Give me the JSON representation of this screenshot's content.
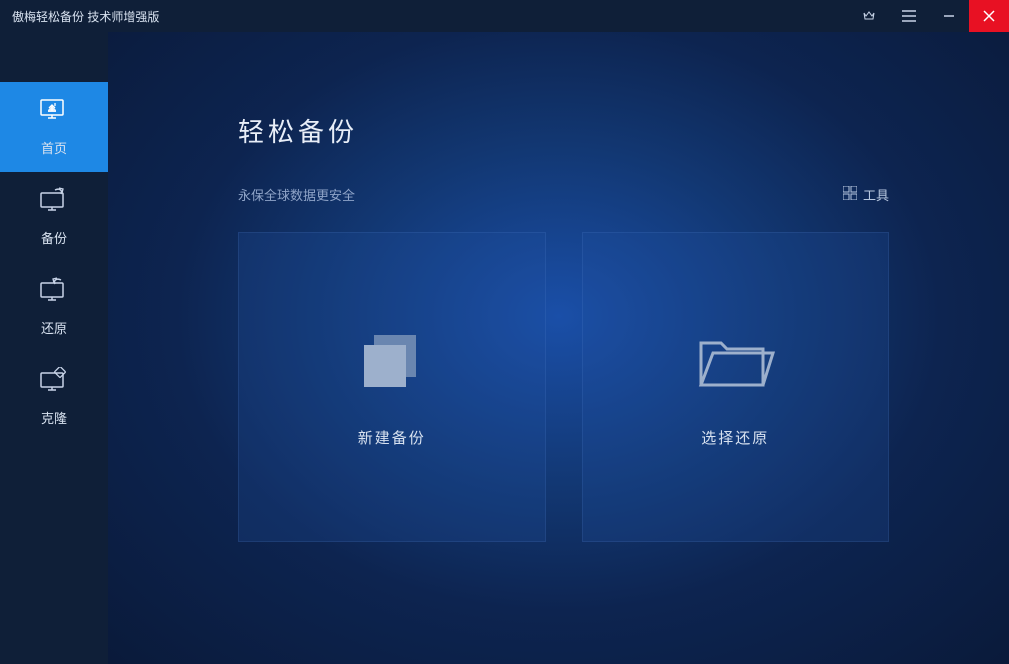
{
  "titlebar": {
    "title": "傲梅轻松备份 技术师增强版"
  },
  "sidebar": {
    "items": [
      {
        "label": "首页"
      },
      {
        "label": "备份"
      },
      {
        "label": "还原"
      },
      {
        "label": "克隆"
      }
    ]
  },
  "main": {
    "title": "轻松备份",
    "subtitle": "永保全球数据更安全",
    "tools": "工具",
    "cards": [
      {
        "label": "新建备份"
      },
      {
        "label": "选择还原"
      }
    ]
  }
}
